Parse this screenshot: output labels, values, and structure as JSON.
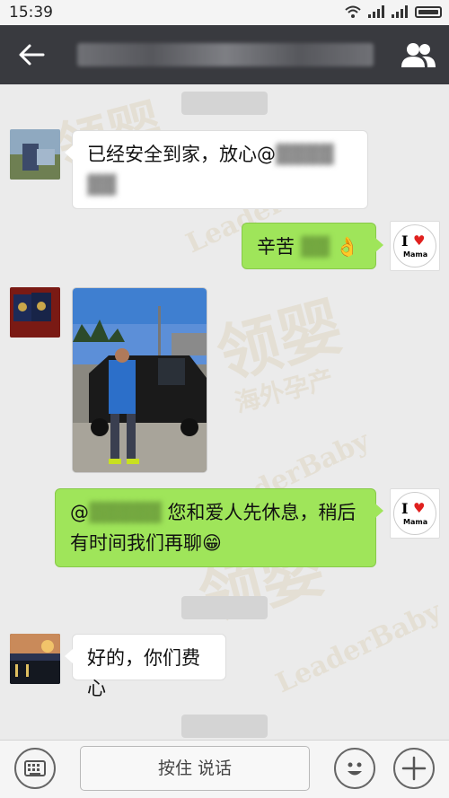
{
  "status_bar": {
    "time": "15:39"
  },
  "header": {
    "title": ""
  },
  "watermark": {
    "brand": "LeaderBaby",
    "cn_big": "领婴",
    "cn_small": "海外孕产"
  },
  "messages": [
    {
      "side": "left",
      "text_prefix": "已经安全到家，放心@",
      "text_rest": ""
    },
    {
      "side": "right",
      "text": "辛苦",
      "emoji": "👌"
    },
    {
      "side": "left",
      "type": "image"
    },
    {
      "side": "right",
      "text_prefix": "@",
      "text_main": "您和爱人先休息，稍后有时间我们再聊",
      "emoji": "😁"
    },
    {
      "side": "left",
      "text": "好的，你们费心"
    }
  ],
  "mama_avatar": {
    "i": "I",
    "heart": "♥",
    "word": "Mama"
  },
  "input_bar": {
    "voice_label": "按住 说话"
  },
  "colors": {
    "titlebar": "#393a3f",
    "my_bubble": "#9fe55a",
    "other_bubble": "#ffffff"
  },
  "icons": [
    "back-arrow-icon",
    "group-members-icon",
    "keyboard-icon",
    "emoji-icon",
    "plus-icon"
  ]
}
